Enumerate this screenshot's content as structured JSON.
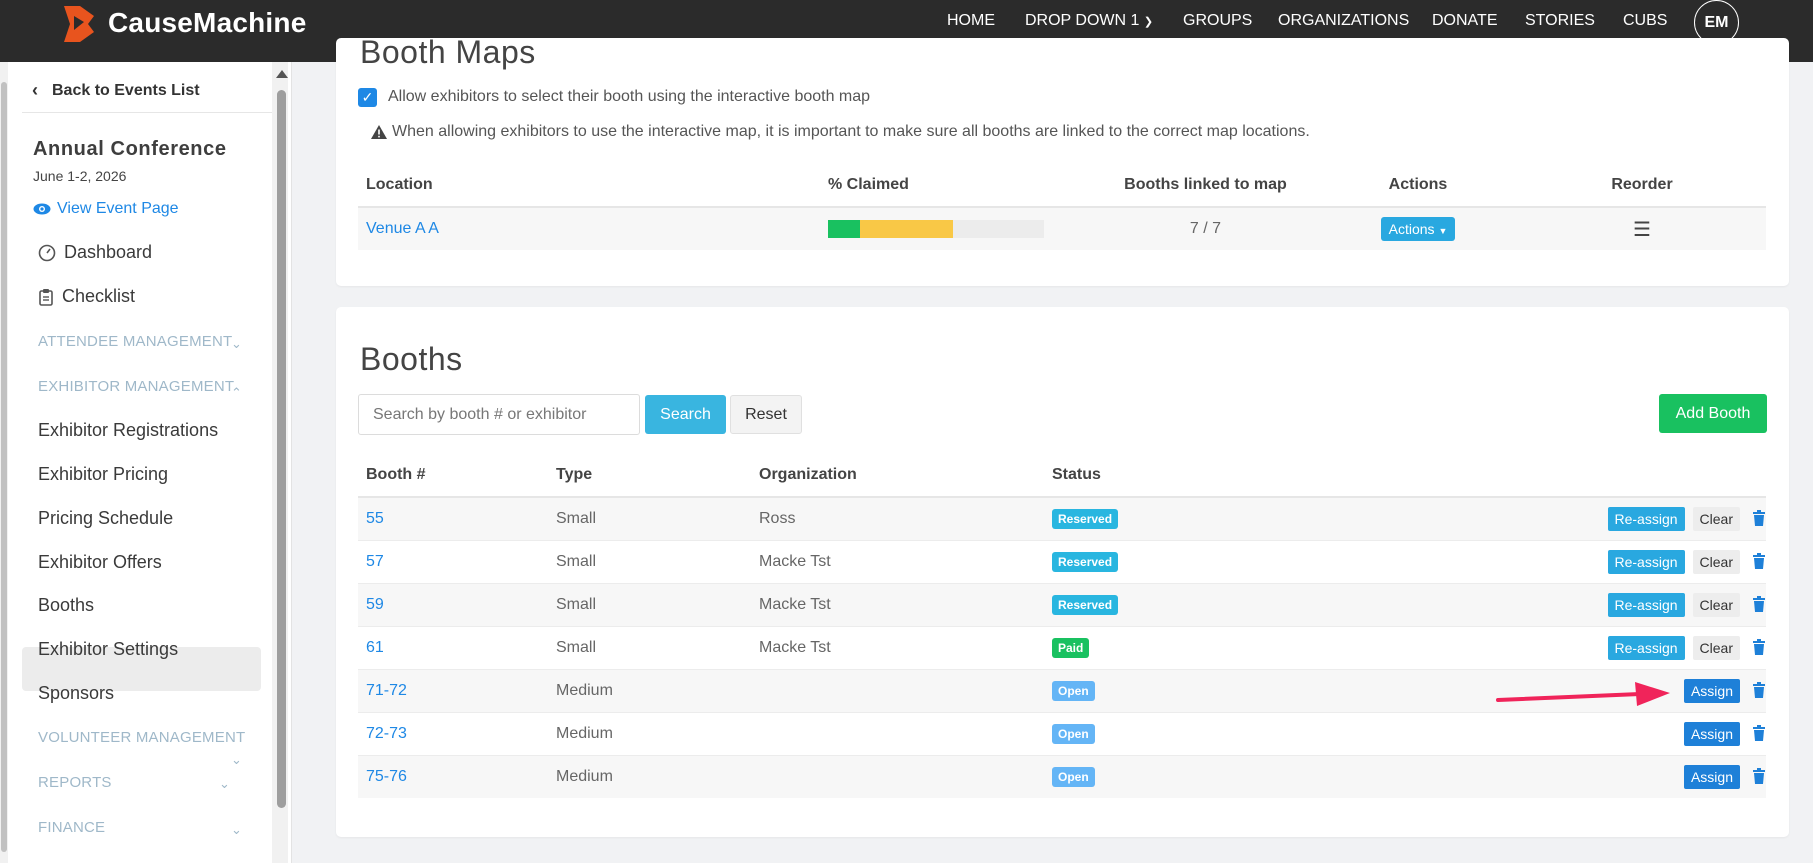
{
  "header": {
    "logo_text": "CauseMachine",
    "nav": [
      "HOME",
      "DROP DOWN 1",
      "GROUPS",
      "ORGANIZATIONS",
      "DONATE",
      "STORIES",
      "CUBS"
    ],
    "avatar_initials": "EM",
    "brand_color": "#e8541e"
  },
  "sidebar": {
    "back_label": "Back to Events List",
    "event_title": "Annual Conference",
    "event_date": "June 1-2, 2026",
    "view_event_label": "View Event Page",
    "dashboard": "Dashboard",
    "checklist": "Checklist",
    "attendee_management": "ATTENDEE MANAGEMENT",
    "exhibitor_management": "EXHIBITOR MANAGEMENT",
    "exhibitor_items": [
      "Exhibitor Registrations",
      "Exhibitor Pricing",
      "Pricing Schedule",
      "Exhibitor Offers",
      "Booths",
      "Exhibitor Settings",
      "Sponsors"
    ],
    "volunteer_management": "VOLUNTEER MANAGEMENT",
    "reports": "REPORTS",
    "finance": "FINANCE",
    "active_item": "Booths"
  },
  "booth_maps": {
    "title": "Booth Maps",
    "allow_label": "Allow exhibitors to select their booth using the interactive booth map",
    "allow_checked": true,
    "warning": "When allowing exhibitors to use the interactive map, it is important to make sure all booths are linked to the correct map locations.",
    "columns": [
      "Location",
      "% Claimed",
      "Booths linked to map",
      "Actions",
      "Reorder"
    ],
    "rows": [
      {
        "location": "Venue A A",
        "claimed": {
          "paid": 0.15,
          "reserved": 0.43
        },
        "linked": "7 / 7",
        "actions_label": "Actions"
      }
    ]
  },
  "booths": {
    "title": "Booths",
    "search_placeholder": "Search by booth # or exhibitor",
    "search_label": "Search",
    "reset_label": "Reset",
    "add_label": "Add Booth",
    "columns": [
      "Booth #",
      "Type",
      "Organization",
      "Status"
    ],
    "reassign_label": "Re-assign",
    "clear_label": "Clear",
    "assign_label": "Assign",
    "rows": [
      {
        "booth": "55",
        "type": "Small",
        "org": "Ross",
        "status": "Reserved"
      },
      {
        "booth": "57",
        "type": "Small",
        "org": "Macke Tst",
        "status": "Reserved"
      },
      {
        "booth": "59",
        "type": "Small",
        "org": "Macke Tst",
        "status": "Reserved"
      },
      {
        "booth": "61",
        "type": "Small",
        "org": "Macke Tst",
        "status": "Paid"
      },
      {
        "booth": "71-72",
        "type": "Medium",
        "org": "",
        "status": "Open"
      },
      {
        "booth": "72-73",
        "type": "Medium",
        "org": "",
        "status": "Open"
      },
      {
        "booth": "75-76",
        "type": "Medium",
        "org": "",
        "status": "Open"
      }
    ]
  },
  "colors": {
    "reserved": "#29b6e0",
    "paid": "#19c160",
    "open": "#64b5f6",
    "claimed_paid": "#19c160",
    "claimed_reserved": "#f9c846",
    "annotation_arrow": "#f0245a"
  }
}
